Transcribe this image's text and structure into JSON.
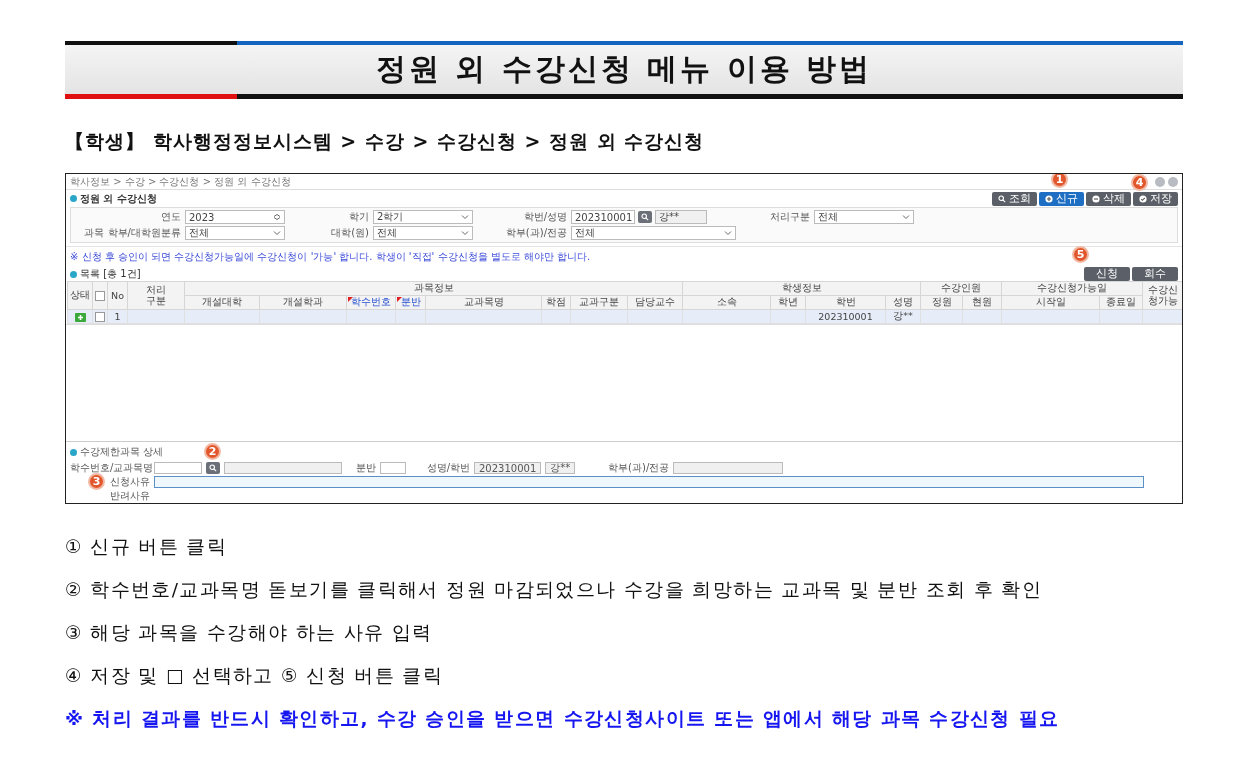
{
  "title": "정원 외 수강신청 메뉴 이용 방법",
  "path": "**【학생】** 학사행정정보시스템  > 수강 > 수강신청 > 정원 외 수강신청",
  "app": {
    "breadcrumb": "학사정보 > 수강 > 수강신청 > 정원 외 수강신청",
    "page_title": "정원 외 수강신청",
    "window_controls_callout": "4",
    "toolbar": [
      {
        "label": "조회",
        "selected": false
      },
      {
        "label": "신규",
        "selected": true,
        "callout": "1"
      },
      {
        "label": "삭제",
        "selected": false
      },
      {
        "label": "저장",
        "selected": false
      }
    ],
    "filters": [
      [
        {
          "label": "연도",
          "kind": "spin",
          "value": "2023"
        },
        {
          "label": "학기",
          "kind": "select",
          "value": "2학기"
        },
        {
          "label": "학번/성명",
          "kind": "lookup",
          "value": "202310001",
          "name": "강**"
        },
        {
          "label": "처리구분",
          "kind": "select",
          "value": "전체"
        }
      ],
      [
        {
          "label": "과목 학부/대학원분류",
          "kind": "select",
          "value": "전체"
        },
        {
          "label": "대학(원)",
          "kind": "select",
          "value": "전체"
        },
        {
          "label": "학부(과)/전공",
          "kind": "select",
          "value": "전체"
        }
      ]
    ],
    "notice": "※ 신청 후 승인이 되면 수강신청가능일에 수강신청이 '가능' 합니다. 학생이 '직접' 수강신청을 별도로 해야만 합니다.",
    "list_title": "목록",
    "list_count": "[총 1건]",
    "actions": [
      {
        "label": "신청",
        "callout": "5"
      },
      {
        "label": "회수"
      }
    ],
    "header": [
      {
        "label": "상태"
      },
      {
        "kind": "checkbox",
        "checked": false
      },
      {
        "label": "No"
      },
      {
        "label": "처리 구분"
      },
      {
        "label": "과목정보",
        "columns": [
          {
            "label": "개설대학",
            "required": false
          },
          {
            "label": "개설학과",
            "required": false
          },
          {
            "label": "학수번호",
            "required": true
          },
          {
            "label": "분반",
            "required": true
          },
          {
            "label": "교과목명",
            "required": false
          },
          {
            "label": "학점",
            "required": false
          },
          {
            "label": "교과구분",
            "required": false
          },
          {
            "label": "담당교수",
            "required": false
          }
        ]
      },
      {
        "label": "학생정보",
        "columns": [
          {
            "label": "소속",
            "required": false
          },
          {
            "label": "학년",
            "required": false
          },
          {
            "label": "학번",
            "required": false
          },
          {
            "label": "성명",
            "required": false
          }
        ]
      },
      {
        "label": "수강인원",
        "columns": [
          {
            "label": "정원",
            "required": false
          },
          {
            "label": "현원",
            "required": false
          }
        ]
      },
      {
        "label": "수강신청가능일",
        "columns": [
          {
            "label": "시작일",
            "required": false
          },
          {
            "label": "종료일",
            "required": false
          }
        ]
      },
      {
        "label": "수강신청가능"
      }
    ],
    "rows": [
      {
        "checked": false,
        "no": "1",
        "student_id": "202310001",
        "student_name": "강**"
      }
    ],
    "detail": {
      "title": "수강제한과목 상세",
      "course_label": "학수번호/교과목명",
      "course_callout": "2",
      "section_label": "분반",
      "student_label": "성명/학번",
      "student_id": "202310001",
      "student_name": "강**",
      "dept_label": "학부(과)/전공",
      "reason_label": "신청사유",
      "reason_callout": "3",
      "reject_label": "반려사유"
    }
  },
  "steps": [
    "① 신규 버튼 클릭",
    "② 학수번호/교과목명 돋보기를 클릭해서 정원 마감되었으나 수강을 희망하는 교과목 및 분반 조회 후 확인",
    "③ 해당 과목을 수강해야 하는 사유 입력",
    "④ 저장 및 □ 선택하고 ⑤ 신청 버튼 클릭"
  ],
  "note": "※ 처리 결과를 반드시 확인하고, 수강 승인을 받으면 수강신청사이트 또는 앱에서 해당 과목 수강신청 필요"
}
